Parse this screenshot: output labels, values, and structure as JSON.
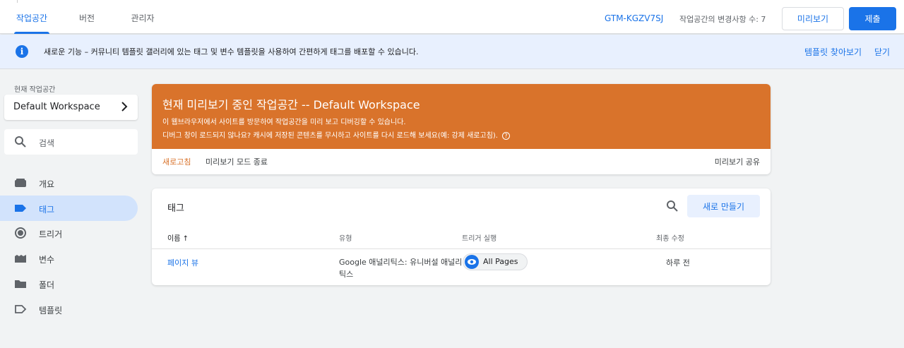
{
  "topbar": {
    "tabs": [
      {
        "label": "작업공간",
        "active": true
      },
      {
        "label": "버전",
        "active": false
      },
      {
        "label": "관리자",
        "active": false
      }
    ],
    "container_id": "GTM-KGZV7SJ",
    "changes_label": "작업공간의 변경사항 수: 7",
    "preview_label": "미리보기",
    "submit_label": "제출"
  },
  "banner": {
    "icon": "info-icon",
    "message": "새로운 기능 – 커뮤니티 템플릿 갤러리에 있는 태그 및 변수 템플릿을 사용하여 간편하게 태그를 배포할 수 있습니다.",
    "browse_label": "템플릿 찾아보기",
    "close_label": "닫기"
  },
  "sidebar": {
    "workspace_label": "현재 작업공간",
    "workspace_name": "Default Workspace",
    "search_placeholder": "검색",
    "items": [
      {
        "label": "개요",
        "icon": "overview-icon",
        "active": false
      },
      {
        "label": "태그",
        "icon": "tag-icon",
        "active": true
      },
      {
        "label": "트리거",
        "icon": "trigger-icon",
        "active": false
      },
      {
        "label": "변수",
        "icon": "variable-icon",
        "active": false
      },
      {
        "label": "폴더",
        "icon": "folder-icon",
        "active": false
      },
      {
        "label": "템플릿",
        "icon": "template-icon",
        "active": false
      }
    ]
  },
  "preview_card": {
    "title": "현재 미리보기 중인 작업공간 -- Default Workspace",
    "line1": "이 웹브라우저에서 사이트를 방문하여 작업공간을 미리 보고 디버깅할 수 있습니다.",
    "line2": "디버그 창이 로드되지 않나요? 캐시에 저장된 콘텐츠를 무시하고 사이트를 다시 로드해 보세요(예: 강제 새로고침).",
    "refresh_label": "새로고침",
    "exit_label": "미리보기 모드 종료",
    "share_label": "미리보기 공유",
    "accent": "#d9732b"
  },
  "tags_card": {
    "title": "태그",
    "new_label": "새로 만들기",
    "columns": [
      "이름 ↑",
      "유형",
      "트리거 실행",
      "최종 수정"
    ],
    "rows": [
      {
        "name": "페이지 뷰",
        "type": "Google 애널리틱스: 유니버설 애널리틱스",
        "trigger": "All Pages",
        "modified": "하루 전"
      }
    ]
  },
  "colors": {
    "primary": "#1a73e8",
    "banner_bg": "#e8f0fe",
    "active_nav": "#d2e3fc"
  }
}
